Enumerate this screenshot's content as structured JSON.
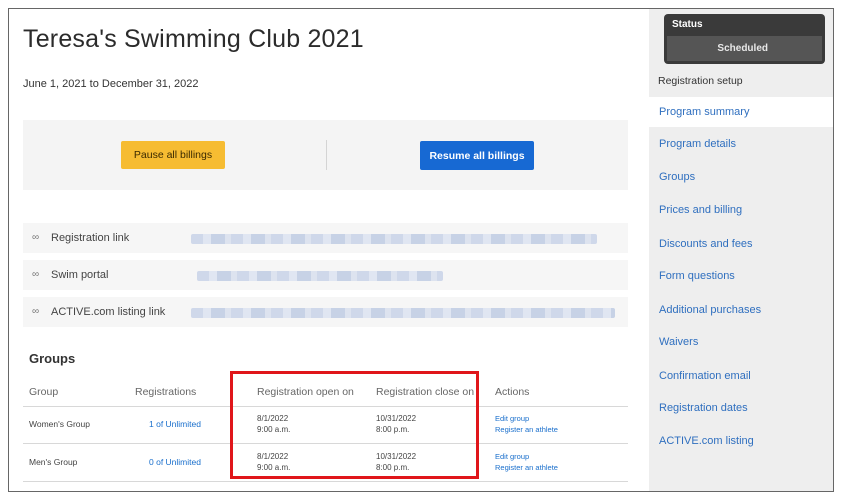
{
  "program": {
    "title": "Teresa's Swimming Club 2021",
    "date_range": "June 1, 2021 to December 31, 2022"
  },
  "billing": {
    "pause_label": "Pause all billings",
    "resume_label": "Resume all billings"
  },
  "links": [
    {
      "label": "Registration link",
      "icon": "link-icon"
    },
    {
      "label": "Swim portal",
      "icon": "link-icon"
    },
    {
      "label": "ACTIVE.com listing link",
      "icon": "link-icon"
    }
  ],
  "groups": {
    "title": "Groups",
    "columns": [
      "Group",
      "Registrations",
      "Registration open on",
      "Registration close on",
      "Actions"
    ],
    "rows": [
      {
        "name": "Women's Group",
        "registrations": "1 of Unlimited",
        "open_date": "8/1/2022",
        "open_time": "9:00 a.m.",
        "close_date": "10/31/2022",
        "close_time": "8:00 p.m.",
        "action_edit": "Edit group",
        "action_register": "Register an athlete"
      },
      {
        "name": "Men's Group",
        "registrations": "0 of Unlimited",
        "open_date": "8/1/2022",
        "open_time": "9:00 a.m.",
        "close_date": "10/31/2022",
        "close_time": "8:00 p.m.",
        "action_edit": "Edit group",
        "action_register": "Register an athlete"
      }
    ]
  },
  "sidebar": {
    "status_label": "Status",
    "status_value": "Scheduled",
    "section_label": "Registration setup",
    "items": [
      {
        "label": "Program summary",
        "active": true
      },
      {
        "label": "Program details"
      },
      {
        "label": "Groups"
      },
      {
        "label": "Prices and billing"
      },
      {
        "label": "Discounts and fees"
      },
      {
        "label": "Form questions"
      },
      {
        "label": "Additional purchases"
      },
      {
        "label": "Waivers"
      },
      {
        "label": "Confirmation email"
      },
      {
        "label": "Registration dates"
      },
      {
        "label": "ACTIVE.com listing"
      }
    ]
  },
  "colors": {
    "pause_button": "#f6bc32",
    "resume_button": "#1769d3",
    "nav_link": "#2f6fbf",
    "highlight_box": "#e0161a",
    "status_box": "#3a3a3a"
  }
}
